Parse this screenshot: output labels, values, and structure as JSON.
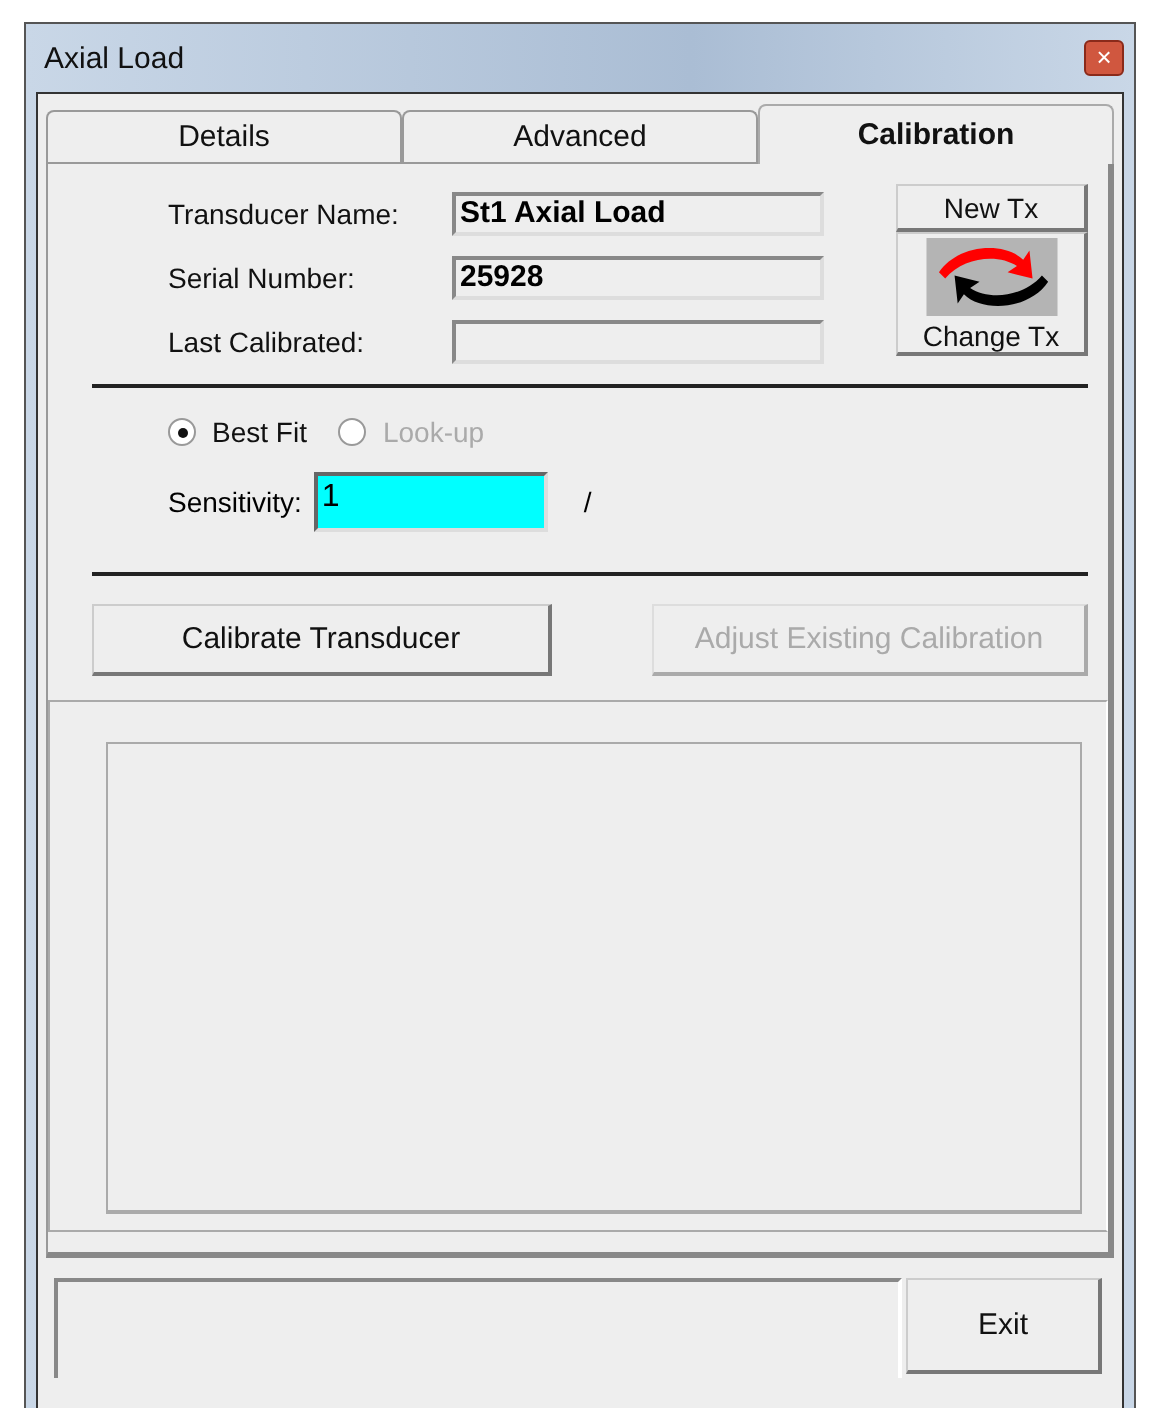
{
  "window": {
    "title": "Axial Load",
    "close": "×"
  },
  "tabs": [
    {
      "label": "Details",
      "selected": false
    },
    {
      "label": "Advanced",
      "selected": false
    },
    {
      "label": "Calibration",
      "selected": true
    }
  ],
  "fields": [
    {
      "label": "Transducer Name:",
      "value": "St1 Axial Load"
    },
    {
      "label": "Serial Number:",
      "value": "25928"
    },
    {
      "label": "Last Calibrated:"
    }
  ],
  "new_tx_button": "New Tx",
  "change_tx_button": "Change Tx",
  "fit_options": [
    {
      "label": "Best Fit",
      "selected": true,
      "disabled": false
    },
    {
      "label": "Look-up",
      "selected": false,
      "disabled": true
    }
  ],
  "sensitivity": {
    "label": "Sensitivity:",
    "value": "1",
    "unit": "/"
  },
  "buttons": [
    {
      "label": "Calibrate Transducer",
      "disabled": false
    },
    {
      "label": "Adjust Existing Calibration",
      "disabled": true
    }
  ],
  "exit_button": "Exit"
}
